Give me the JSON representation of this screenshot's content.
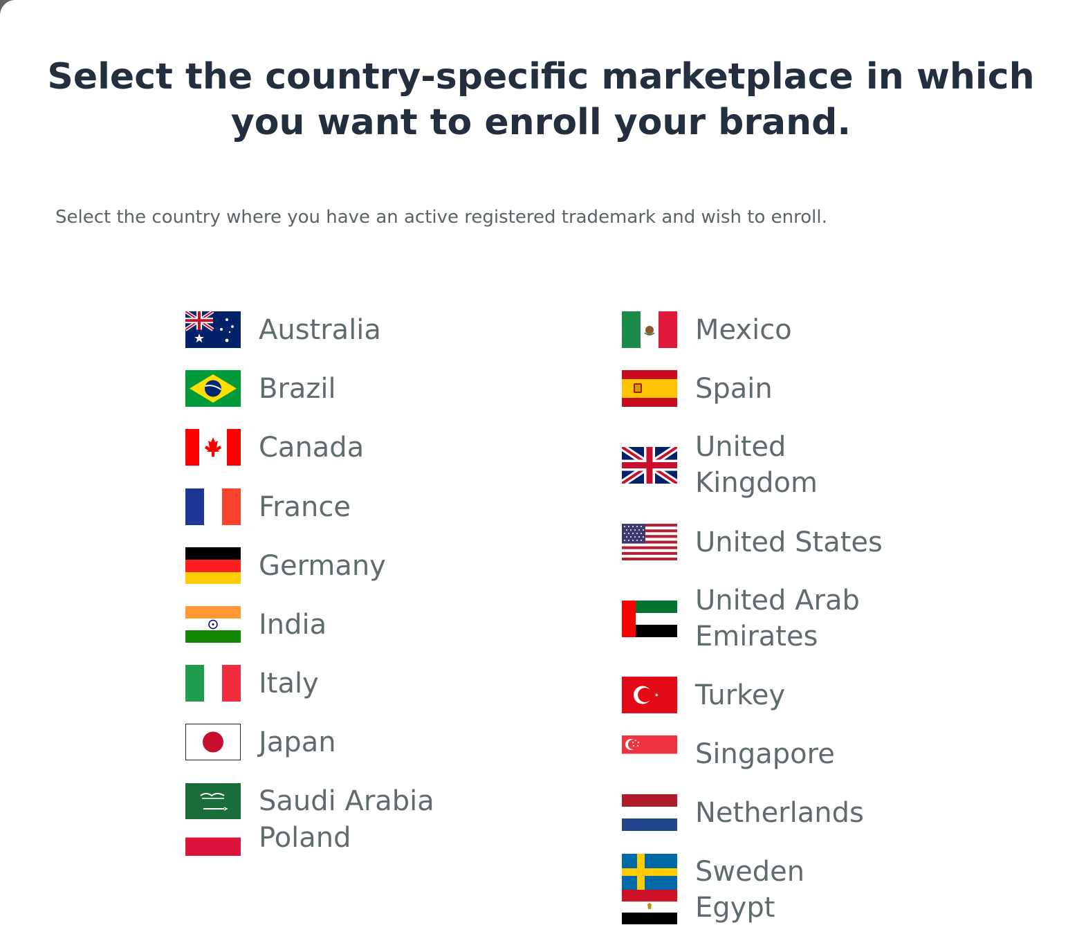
{
  "heading": "Select the country-specific marketplace in which you want to enroll your brand.",
  "subheading": "Select the country where you have an active registered trademark and wish to enroll.",
  "countries_left": {
    "australia": {
      "name": "Australia",
      "flag": "australia-flag-icon"
    },
    "brazil": {
      "name": "Brazil",
      "flag": "brazil-flag-icon"
    },
    "canada": {
      "name": "Canada",
      "flag": "canada-flag-icon"
    },
    "france": {
      "name": "France",
      "flag": "france-flag-icon"
    },
    "germany": {
      "name": "Germany",
      "flag": "germany-flag-icon"
    },
    "india": {
      "name": "India",
      "flag": "india-flag-icon"
    },
    "italy": {
      "name": "Italy",
      "flag": "italy-flag-icon"
    },
    "japan": {
      "name": "Japan",
      "flag": "japan-flag-icon"
    },
    "saudi_arabia": {
      "name": "Saudi Arabia",
      "flag": "saudi-arabia-flag-icon"
    },
    "poland": {
      "name": "Poland",
      "flag": "poland-flag-icon"
    }
  },
  "countries_right": {
    "mexico": {
      "name": "Mexico",
      "flag": "mexico-flag-icon"
    },
    "spain": {
      "name": "Spain",
      "flag": "spain-flag-icon"
    },
    "united_kingdom": {
      "name": "United Kingdom",
      "flag": "united-kingdom-flag-icon"
    },
    "united_states": {
      "name": "United States",
      "flag": "united-states-flag-icon"
    },
    "uae": {
      "name": "United Arab Emirates",
      "flag": "uae-flag-icon"
    },
    "turkey": {
      "name": "Turkey",
      "flag": "turkey-flag-icon"
    },
    "singapore": {
      "name": "Singapore",
      "flag": "singapore-flag-icon"
    },
    "netherlands": {
      "name": "Netherlands",
      "flag": "netherlands-flag-icon"
    },
    "sweden": {
      "name": "Sweden",
      "flag": "sweden-flag-icon"
    },
    "egypt": {
      "name": "Egypt",
      "flag": "egypt-flag-icon"
    }
  },
  "colors": {
    "heading": "#232f3e",
    "text": "#5f6b6e",
    "background": "#ffffff"
  }
}
